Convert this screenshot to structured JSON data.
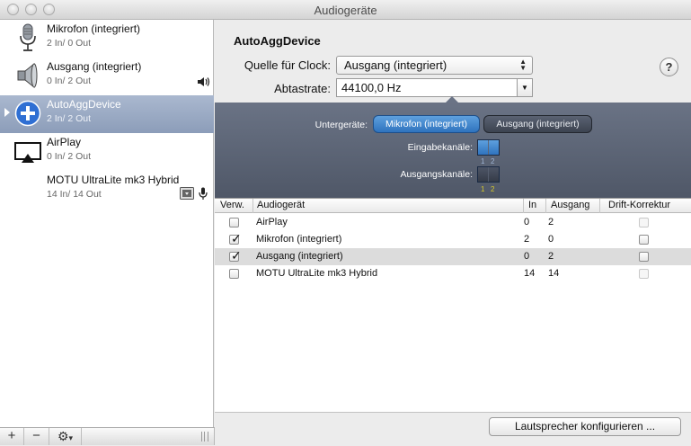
{
  "window": {
    "title": "Audiogeräte"
  },
  "sidebar": {
    "devices": [
      {
        "name": "Mikrofon (integriert)",
        "io": "2 In/ 0 Out",
        "icon": "microphone-icon"
      },
      {
        "name": "Ausgang (integriert)",
        "io": "0 In/ 2 Out",
        "icon": "speaker-icon"
      },
      {
        "name": "AutoAggDevice",
        "io": "2 In/ 2 Out",
        "icon": "plus-circle-icon",
        "selected": true
      },
      {
        "name": "AirPlay",
        "io": "0 In/ 2 Out",
        "icon": "airplay-icon"
      },
      {
        "name": "MOTU UltraLite mk3 Hybrid",
        "io": "14 In/ 14 Out",
        "icon": "none"
      }
    ],
    "toolbar": {
      "add": "+",
      "remove": "−",
      "gear": "⚙",
      "caret": "▾"
    }
  },
  "detail": {
    "title": "AutoAggDevice",
    "clock_label": "Quelle für Clock:",
    "clock_value": "Ausgang (integriert)",
    "rate_label": "Abtastrate:",
    "rate_value": "44100,0 Hz",
    "help": "?",
    "subdevices_label": "Untergeräte:",
    "subdevices": [
      {
        "name": "Mikrofon (integriert)",
        "active": true
      },
      {
        "name": "Ausgang (integriert)",
        "active": false
      }
    ],
    "input_label": "Eingabekanäle:",
    "input_channels": [
      "1",
      "2"
    ],
    "output_label": "Ausgangskanäle:",
    "output_channels": [
      "1",
      "2"
    ],
    "accent": "#2f73be",
    "channel_number_color": "#d6c92a"
  },
  "table": {
    "headers": {
      "use": "Verw.",
      "device": "Audiogerät",
      "in": "In",
      "out": "Ausgang",
      "drift": "Drift-Korrektur"
    },
    "rows": [
      {
        "use": false,
        "device": "AirPlay",
        "in": "0",
        "out": "2",
        "drift_enabled": false,
        "selected": false
      },
      {
        "use": true,
        "device": "Mikrofon (integriert)",
        "in": "2",
        "out": "0",
        "drift_enabled": true,
        "selected": false
      },
      {
        "use": true,
        "device": "Ausgang (integriert)",
        "in": "0",
        "out": "2",
        "drift_enabled": true,
        "selected": true
      },
      {
        "use": false,
        "device": "MOTU UltraLite mk3 Hybrid",
        "in": "14",
        "out": "14",
        "drift_enabled": false,
        "selected": false
      }
    ],
    "check_mark": "✓"
  },
  "footer": {
    "configure_speakers": "Lautsprecher konfigurieren ..."
  }
}
